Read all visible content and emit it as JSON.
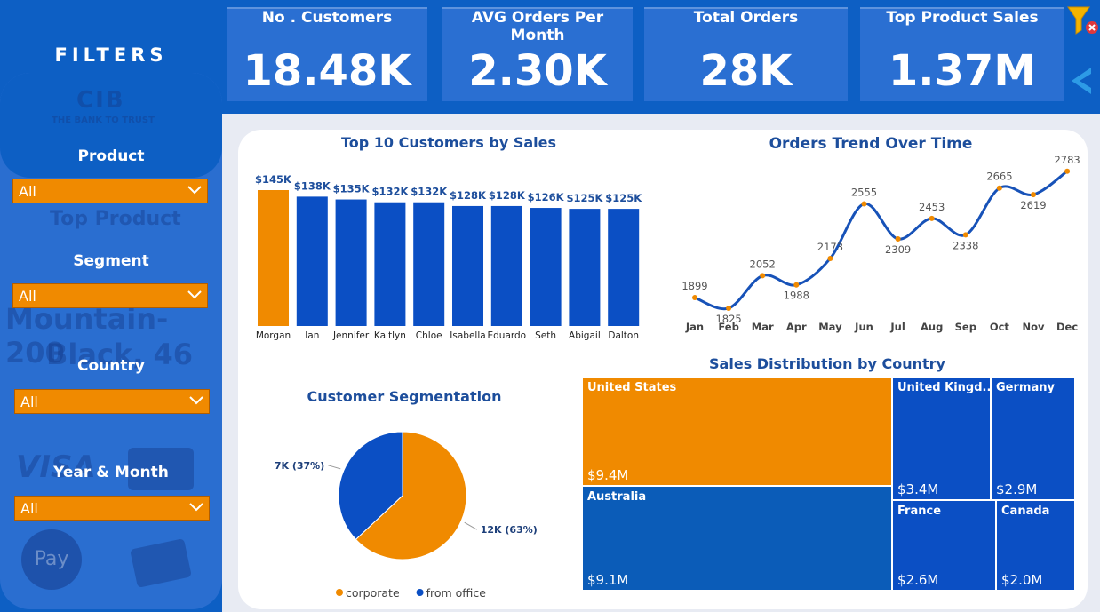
{
  "sidebar": {
    "title": "FILTERS",
    "watermark": {
      "bank": "THE BANK TO TRUST",
      "logo_text": "CIB",
      "product_label": "Top Product",
      "product_line1": "Mountain-200",
      "product_line2": "Black, 46",
      "visa": "VISA",
      "applepay": "Pay"
    },
    "filters": [
      {
        "label": "Product",
        "value": "All"
      },
      {
        "label": "Segment",
        "value": "All"
      },
      {
        "label": "Country",
        "value": "All"
      },
      {
        "label": "Year & Month",
        "value": "All"
      }
    ]
  },
  "kpis": [
    {
      "label": "No . Customers",
      "value": "18.48K"
    },
    {
      "label": "AVG Orders Per Month",
      "value": "2.30K"
    },
    {
      "label": "Total Orders",
      "value": "28K"
    },
    {
      "label": "Top Product Sales",
      "value": "1.37M"
    }
  ],
  "colors": {
    "blue": "#0b4fc4",
    "orange": "#f08a00",
    "line": "#1752b8",
    "title": "#1d4e9c",
    "band": "#0d5fc4"
  },
  "chart_data": [
    {
      "type": "bar",
      "title": "Top 10 Customers by Sales",
      "categories": [
        "Morgan",
        "Ian",
        "Jennifer",
        "Kaitlyn",
        "Chloe",
        "Isabella",
        "Eduardo",
        "Seth",
        "Abigail",
        "Dalton"
      ],
      "values": [
        145,
        138,
        135,
        132,
        132,
        128,
        128,
        126,
        125,
        125
      ],
      "labels": [
        "$145K",
        "$138K",
        "$135K",
        "$132K",
        "$132K",
        "$128K",
        "$128K",
        "$126K",
        "$125K",
        "$125K"
      ],
      "highlight_index": 0,
      "ylim": [
        0,
        145
      ]
    },
    {
      "type": "line",
      "title": "Orders Trend Over Time",
      "categories": [
        "Jan",
        "Feb",
        "Mar",
        "Apr",
        "May",
        "Jun",
        "Jul",
        "Aug",
        "Sep",
        "Oct",
        "Nov",
        "Dec"
      ],
      "values": [
        1899,
        1825,
        2052,
        1988,
        2173,
        2555,
        2309,
        2453,
        2338,
        2665,
        2619,
        2783
      ],
      "ylim": [
        1800,
        2800
      ]
    },
    {
      "type": "pie",
      "title": "Customer Segmentation",
      "slices": [
        {
          "name": "corporate",
          "value": 63,
          "label": "12K (63%)"
        },
        {
          "name": "from office",
          "value": 37,
          "label": "7K (37%)"
        }
      ]
    },
    {
      "type": "treemap",
      "title": "Sales Distribution by Country",
      "items": [
        {
          "name": "United States",
          "value": "$9.4M"
        },
        {
          "name": "Australia",
          "value": "$9.1M"
        },
        {
          "name": "United Kingd...",
          "value": "$3.4M"
        },
        {
          "name": "Germany",
          "value": "$2.9M"
        },
        {
          "name": "France",
          "value": "$2.6M"
        },
        {
          "name": "Canada",
          "value": "$2.0M"
        }
      ]
    }
  ]
}
